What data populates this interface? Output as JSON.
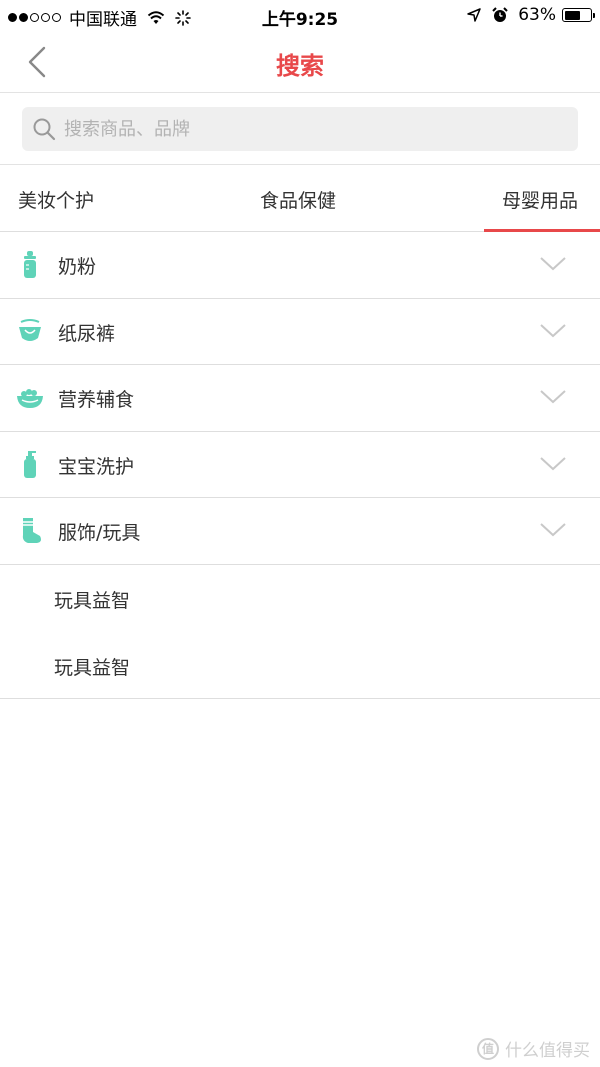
{
  "status_bar": {
    "carrier": "中国联通",
    "time": "上午9:25",
    "battery": "63%",
    "battery_level": 0.63,
    "signal_bars_filled": 2,
    "signal_bars_total": 5
  },
  "nav": {
    "title": "搜索",
    "back_icon": "chevron-left-icon"
  },
  "search": {
    "placeholder": "搜索商品、品牌",
    "value": "",
    "icon": "search-icon"
  },
  "tabs": [
    {
      "label": "美妆个护",
      "active": false
    },
    {
      "label": "食品保健",
      "active": false
    },
    {
      "label": "母婴用品",
      "active": true
    }
  ],
  "categories": [
    {
      "label": "奶粉",
      "icon": "baby-bottle-icon"
    },
    {
      "label": "纸尿裤",
      "icon": "diaper-icon"
    },
    {
      "label": "营养辅食",
      "icon": "food-bowl-icon"
    },
    {
      "label": "宝宝洗护",
      "icon": "lotion-bottle-icon"
    },
    {
      "label": "服饰/玩具",
      "icon": "sock-icon"
    }
  ],
  "sub_items": [
    {
      "label": "玩具益智"
    },
    {
      "label": "玩具益智"
    }
  ],
  "watermark": {
    "logo_text": "值",
    "text": "什么值得买"
  },
  "colors": {
    "accent": "#e8484a",
    "icon_teal": "#5fd3b8",
    "divider": "#dedede",
    "search_bg": "#efefef"
  }
}
